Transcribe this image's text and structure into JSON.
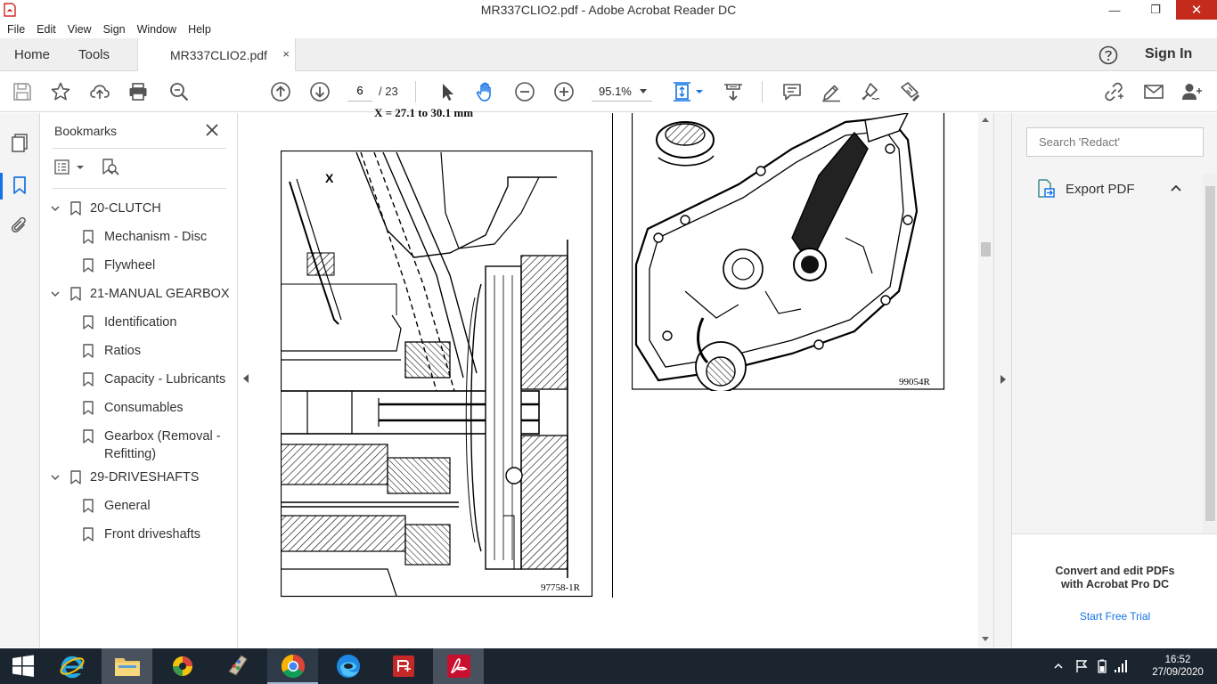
{
  "window": {
    "title": "MR337CLIO2.pdf - Adobe Acrobat Reader DC",
    "minimize": "—",
    "maximize": "❐",
    "close": "✕"
  },
  "menu": [
    "File",
    "Edit",
    "View",
    "Sign",
    "Window",
    "Help"
  ],
  "tabs": {
    "home": "Home",
    "tools": "Tools",
    "document": "MR337CLIO2.pdf",
    "close": "×",
    "sign_in": "Sign In"
  },
  "toolbar": {
    "page_current": "6",
    "page_total": "/ 23",
    "zoom": "95.1%"
  },
  "bookmarks": {
    "title": "Bookmarks",
    "items": [
      {
        "label": "20-CLUTCH",
        "level": 0
      },
      {
        "label": "Mechanism - Disc",
        "level": 1
      },
      {
        "label": "Flywheel",
        "level": 1
      },
      {
        "label": "21-MANUAL GEARBOX",
        "level": 0
      },
      {
        "label": "Identification",
        "level": 1
      },
      {
        "label": "Ratios",
        "level": 1
      },
      {
        "label": "Capacity - Lubricants",
        "level": 1
      },
      {
        "label": "Consumables",
        "level": 1
      },
      {
        "label": "Gearbox (Removal -",
        "label2": "Refitting)",
        "level": 1
      },
      {
        "label": "29-DRIVESHAFTS",
        "level": 0
      },
      {
        "label": "General",
        "level": 1
      },
      {
        "label": "Front driveshafts",
        "level": 1
      }
    ]
  },
  "document": {
    "top_caption": "X = 27.1 to 30.1 mm",
    "fig1_label": "X",
    "fig1_ref": "97758-1R",
    "fig2_ref": "99054R"
  },
  "right_pane": {
    "search_placeholder": "Search 'Redact'",
    "export_label": "Export PDF",
    "promo_line1": "Convert and edit PDFs",
    "promo_line2": "with Acrobat Pro DC",
    "trial_link": "Start Free Trial"
  },
  "taskbar": {
    "apps": [
      "internet-explorer",
      "file-explorer",
      "photos",
      "paint",
      "chrome",
      "edge",
      "pdf-tool",
      "acrobat-reader"
    ],
    "time": "16:52",
    "date": "27/09/2020"
  }
}
